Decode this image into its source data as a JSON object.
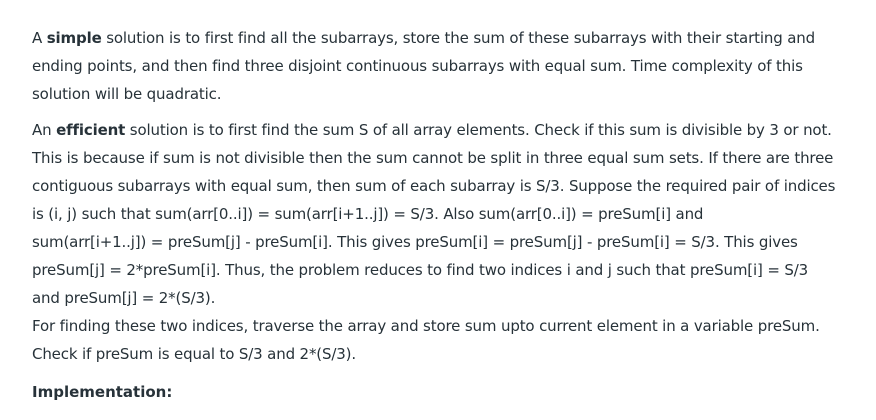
{
  "para1": {
    "l1_pre": "A ",
    "l1_bold": "simple",
    "l1_post": " solution is to first find all the subarrays, store the sum of these subarrays with their starting and",
    "l2": "ending points, and then find three disjoint continuous subarrays with equal sum. Time complexity of this",
    "l3": "solution will be quadratic."
  },
  "para2": {
    "l1_pre": "An ",
    "l1_bold": "efficient",
    "l1_post": " solution is to first find the sum S of all array elements. Check if this sum is divisible by 3 or not.",
    "l2": "This is because if sum is not divisible then the sum cannot be split in three equal sum sets. If there are three",
    "l3": "contiguous subarrays with equal sum, then sum of each subarray is S/3. Suppose the required pair of indices",
    "l4": "is (i, j) such that sum(arr[0..i]) = sum(arr[i+1..j]) = S/3. Also sum(arr[0..i]) = preSum[i] and",
    "l5": "sum(arr[i+1..j]) = preSum[j] - preSum[i]. This gives preSum[i] = preSum[j] - preSum[i] = S/3. This gives",
    "l6": "preSum[j] = 2*preSum[i]. Thus, the problem reduces to find two indices i and j such that preSum[i] = S/3",
    "l7": "and preSum[j] = 2*(S/3)."
  },
  "para3": {
    "l1": "For finding these two indices, traverse the array and store sum upto current element in a variable preSum.",
    "l2": "Check if preSum is equal to S/3 and 2*(S/3)."
  },
  "implementation_heading": "Implementation:"
}
